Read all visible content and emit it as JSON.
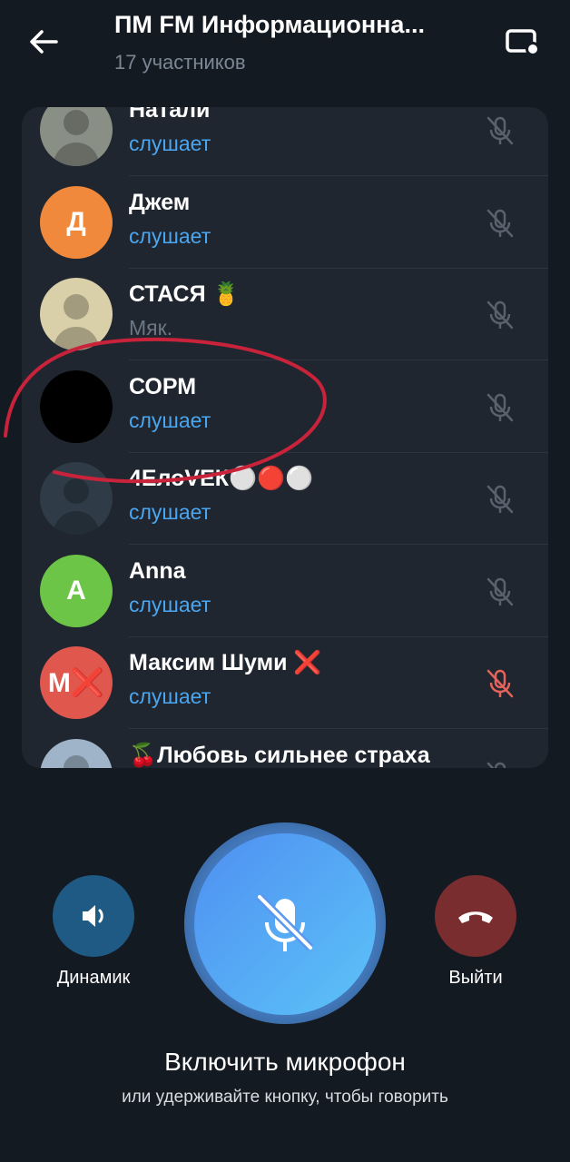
{
  "header": {
    "title": "ПМ FM Информационна...",
    "subtitle": "17 участников",
    "back_icon": "arrow-left-icon",
    "screen_icon": "screen-share-icon"
  },
  "participants": [
    {
      "name": "Натали",
      "status": "слушает",
      "avatar_text": "",
      "avatar_color": "#8a8f86",
      "muted_red": false
    },
    {
      "name": "Джем",
      "status": "слушает",
      "avatar_text": "Д",
      "avatar_color": "#f0893c",
      "muted_red": false
    },
    {
      "name": "СТАСЯ 🍍",
      "status": "Мяк.",
      "avatar_text": "",
      "avatar_color": "#d9cfa8",
      "muted_red": false
    },
    {
      "name": "СОРМ",
      "status": "слушает",
      "avatar_text": "",
      "avatar_color": "#000000",
      "muted_red": false
    },
    {
      "name": "4ЕлоVЕК⚪🔴⚪",
      "status": "слушает",
      "avatar_text": "",
      "avatar_color": "#2f3c48",
      "muted_red": false
    },
    {
      "name": "Anna",
      "status": "слушает",
      "avatar_text": "A",
      "avatar_color": "#6cc547",
      "muted_red": false
    },
    {
      "name": "Максим Шуми ❌",
      "status": "слушает",
      "avatar_text": "М❌",
      "avatar_color": "#e0574d",
      "muted_red": true
    },
    {
      "name": "🍒Любовь сильнее страха",
      "status": "",
      "avatar_text": "",
      "avatar_color": "#9fb4c8",
      "muted_red": false
    }
  ],
  "controls": {
    "speaker_label": "Динамик",
    "leave_label": "Выйти",
    "main_label": "Включить микрофон",
    "hint": "или удерживайте кнопку, чтобы говорить"
  },
  "colors": {
    "accent": "#4aa6f0",
    "speaker_bg": "#1f5a84",
    "leave_bg": "#7a2d2f",
    "mic_red": "#e5635a",
    "mic_gray": "#58616c"
  }
}
